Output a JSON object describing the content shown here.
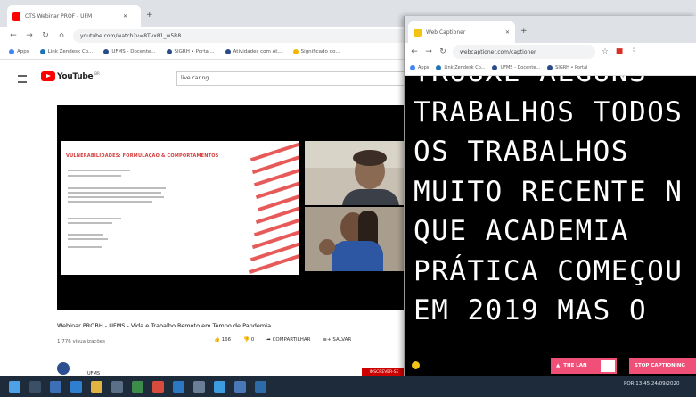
{
  "main_browser": {
    "tab_title": "CTS Webinar PROF - UFM",
    "url": "youtube.com/watch?v=8Tvx81_w5R8",
    "bookmarks": [
      "Apps",
      "Link Zendesk Co...",
      "UFMS - Docente...",
      "SIGRH • Portal...",
      "Atividades com At...",
      "Significado do..."
    ]
  },
  "youtube": {
    "logo_text": "YouTube",
    "logo_country": "BR",
    "search_value": "live caring"
  },
  "slide": {
    "title": "VULNERABILIDADES: FORMULAÇÃO & COMPORTAMENTOS"
  },
  "video": {
    "title": "Webinar PROBH - UFMS - Vida e Trabalho Remoto em Tempo de Pandemia",
    "views": "1.776 visualizações",
    "actions": [
      "166",
      "0",
      "COMPARTILHAR",
      "SALVAR"
    ],
    "channel": "UFMS",
    "subscribe_label": "INSCREVER-SE"
  },
  "caption_window": {
    "tab_title": "Web Captioner",
    "url": "webcaptioner.com/captioner",
    "bookmarks": [
      "Apps",
      "Link Zendesk Co...",
      "UFMS - Docente...",
      "SIGRH • Portal"
    ],
    "lines": [
      "TROUXE ALGUNS",
      "TRABALHOS TODOS",
      "OS TRABALHOS",
      "MUITO RECENTE N",
      "QUE ACADEMIA",
      "PRÁTICA COMEÇOU",
      "EM 2019 MAS O"
    ],
    "language_button": "THE LAN",
    "stop_button": "STOP CAPTIONING"
  },
  "taskbar": {
    "time": "13:45",
    "date": "24/09/2020",
    "lang": "POR"
  },
  "colors": {
    "youtube_red": "#ff0000",
    "caption_button": "#f04f78",
    "status_dot": "#f3c414",
    "taskbar": "#1d2b3a"
  }
}
